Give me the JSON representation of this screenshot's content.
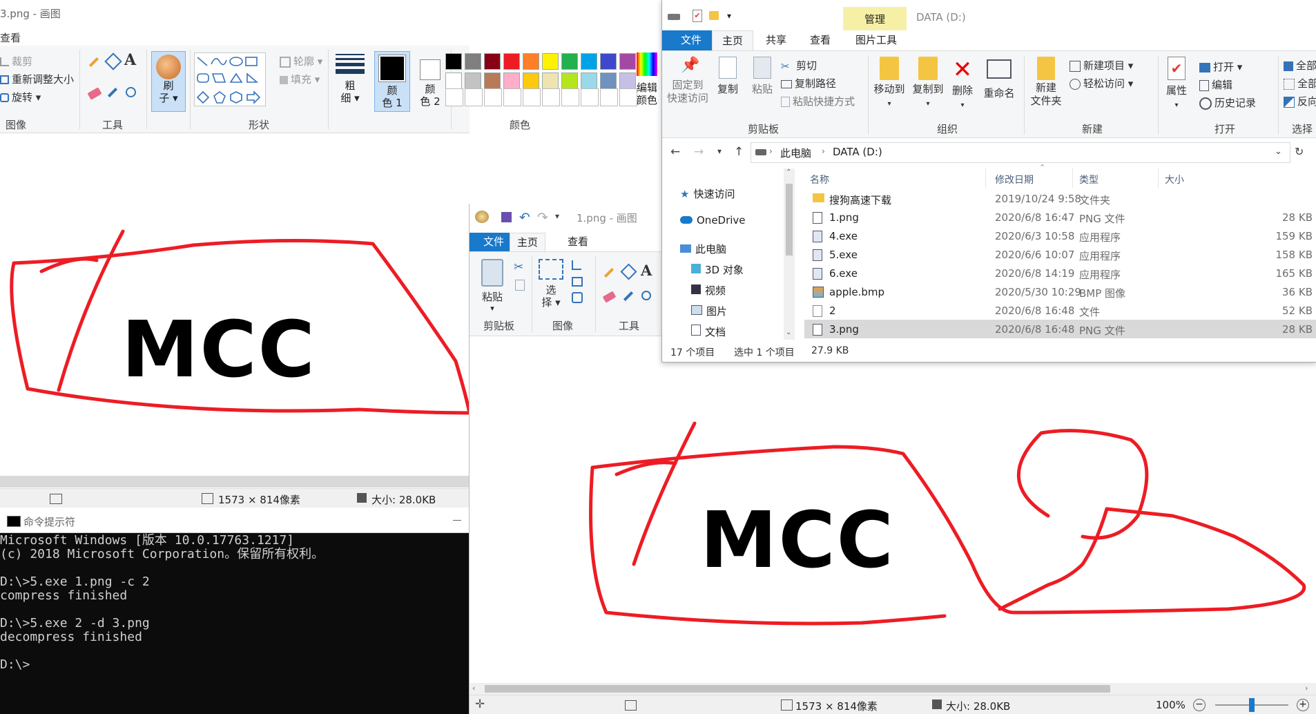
{
  "paint_back": {
    "title": "3.png - 画图",
    "view_tab": "查看",
    "image_group": {
      "crop": "裁剪",
      "resize": "重新调整大小",
      "rotate": "旋转",
      "label": "图像"
    },
    "tools_label": "工具",
    "brush": {
      "line1": "刷",
      "line2": "子"
    },
    "shapes": {
      "outline": "轮廓",
      "fill": "填充",
      "label": "形状"
    },
    "size": {
      "line1": "粗",
      "line2": "细"
    },
    "color1": {
      "line1": "颜",
      "line2": "色 1"
    },
    "color2": {
      "line1": "颜",
      "line2": "色 2"
    },
    "colors_label": "颜色",
    "edit_colors": {
      "line1": "编辑",
      "line2": "颜色"
    },
    "canvas_text": "MCC",
    "status": {
      "dimensions": "1573 × 814像素",
      "size": "大小: 28.0KB"
    }
  },
  "palette_colors": [
    "#000000",
    "#7f7f7f",
    "#880015",
    "#ed1c24",
    "#ff7f27",
    "#fff200",
    "#22b14c",
    "#00a2e8",
    "#3f48cc",
    "#a349a4",
    "#ffffff",
    "#c3c3c3",
    "#b97a57",
    "#ffaec9",
    "#ffc90e",
    "#efe4b0",
    "#b5e61d",
    "#99d9ea",
    "#7092be",
    "#c8bfe7"
  ],
  "cmd": {
    "title": "命令提示符",
    "lines": [
      "Microsoft Windows [版本 10.0.17763.1217]",
      "(c) 2018 Microsoft Corporation。保留所有权利。",
      "",
      "D:\\>5.exe 1.png -c 2",
      "compress finished",
      "",
      "D:\\>5.exe 2 -d 3.png",
      "decompress finished",
      "",
      "D:\\>"
    ]
  },
  "paint_front": {
    "title": "1.png - 画图",
    "tabs": [
      "文件",
      "主页",
      "查看"
    ],
    "paste": "粘贴",
    "clipboard_label": "剪贴板",
    "select": {
      "line1": "选",
      "line2": "择"
    },
    "image_label": "图像",
    "tools_label": "工具",
    "canvas_text": "MCC",
    "status": {
      "dimensions": "1573 × 814像素",
      "size": "大小: 28.0KB",
      "zoom": "100%"
    },
    "zoom_level": 0.5
  },
  "explorer": {
    "title": "DATA (D:)",
    "manage_tab": "管理",
    "picture_tools": "图片工具",
    "tabs": [
      "文件",
      "主页",
      "共享",
      "查看"
    ],
    "clipboard": {
      "pin_line1": "固定到",
      "pin_line2": "快速访问",
      "copy": "复制",
      "paste": "粘贴",
      "cut": "剪切",
      "copy_path": "复制路径",
      "paste_shortcut": "粘贴快捷方式",
      "label": "剪贴板"
    },
    "organize": {
      "move_to": "移动到",
      "copy_to": "复制到",
      "delete": "删除",
      "rename": "重命名",
      "label": "组织"
    },
    "new": {
      "new_folder_line1": "新建",
      "new_folder_line2": "文件夹",
      "new_item": "新建项目",
      "easy_access": "轻松访问",
      "label": "新建"
    },
    "open": {
      "properties": "属性",
      "open": "打开",
      "edit": "编辑",
      "history": "历史记录",
      "label": "打开"
    },
    "select": {
      "select_all": "全部选择",
      "select_none": "全部取消",
      "invert": "反向选择",
      "label": "选择"
    },
    "breadcrumb": [
      "此电脑",
      "DATA (D:)"
    ],
    "nav": [
      "快速访问",
      "OneDrive",
      "此电脑",
      "3D 对象",
      "视频",
      "图片",
      "文档"
    ],
    "columns": [
      "名称",
      "修改日期",
      "类型",
      "大小"
    ],
    "files": [
      {
        "name": "搜狗高速下载",
        "date": "2019/10/24 9:58",
        "type": "文件夹",
        "size": "",
        "icon": "folder"
      },
      {
        "name": "1.png",
        "date": "2020/6/8 16:47",
        "type": "PNG 文件",
        "size": "28 KB",
        "icon": "png"
      },
      {
        "name": "4.exe",
        "date": "2020/6/3 10:58",
        "type": "应用程序",
        "size": "159 KB",
        "icon": "exe"
      },
      {
        "name": "5.exe",
        "date": "2020/6/6 10:07",
        "type": "应用程序",
        "size": "158 KB",
        "icon": "exe"
      },
      {
        "name": "6.exe",
        "date": "2020/6/8 14:19",
        "type": "应用程序",
        "size": "165 KB",
        "icon": "exe"
      },
      {
        "name": "apple.bmp",
        "date": "2020/5/30 10:29",
        "type": "BMP 图像",
        "size": "36 KB",
        "icon": "bmp"
      },
      {
        "name": "2",
        "date": "2020/6/8 16:48",
        "type": "文件",
        "size": "52 KB",
        "icon": "file"
      },
      {
        "name": "3.png",
        "date": "2020/6/8 16:48",
        "type": "PNG 文件",
        "size": "28 KB",
        "icon": "png",
        "selected": true
      }
    ],
    "status": {
      "count": "17 个项目",
      "selected": "选中 1 个项目",
      "size": "27.9 KB"
    }
  }
}
